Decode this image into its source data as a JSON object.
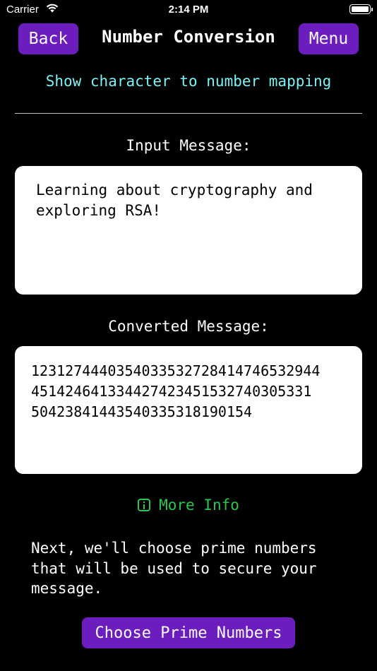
{
  "status_bar": {
    "carrier": "Carrier",
    "time": "2:14 PM",
    "wifi_icon": "wifi-icon",
    "battery_icon": "battery-icon"
  },
  "nav": {
    "back_label": "Back",
    "title": "Number Conversion",
    "menu_label": "Menu"
  },
  "mapping_link": "Show character to number mapping",
  "input": {
    "label": "Input Message:",
    "value": "Learning about cryptography and exploring RSA!"
  },
  "converted": {
    "label": "Converted Message:",
    "lines": [
      "1231274440354033532728414746532944",
      "451424641334427423451532740305331",
      "50423841443540335318190154"
    ]
  },
  "more_info": {
    "label": "More Info",
    "icon": "info-icon"
  },
  "next_text": "Next, we'll choose prime numbers that will be used to secure your message.",
  "choose_button_label": "Choose Prime Numbers",
  "colors": {
    "background": "#000000",
    "button": "#6c1dbd",
    "link": "#7ff0f4",
    "more_info": "#28c74f"
  }
}
